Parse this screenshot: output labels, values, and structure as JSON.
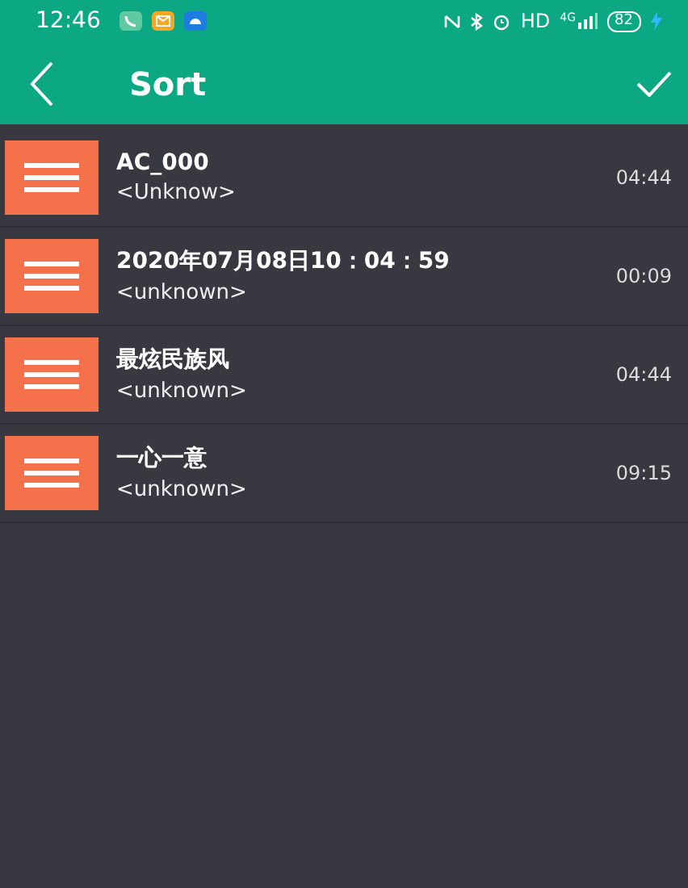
{
  "status_bar": {
    "time": "12:46",
    "network": "HD",
    "signal_type": "4G",
    "battery": "82"
  },
  "toolbar": {
    "title": "Sort"
  },
  "tracks": [
    {
      "title": "AC_000",
      "artist": "<Unknow>",
      "duration": "04:44"
    },
    {
      "title": "2020年07月08日10：04：59",
      "artist": "<unknown>",
      "duration": "00:09"
    },
    {
      "title": "最炫民族风",
      "artist": "<unknown>",
      "duration": "04:44"
    },
    {
      "title": "一心一意",
      "artist": "<unknown>",
      "duration": "09:15"
    }
  ]
}
